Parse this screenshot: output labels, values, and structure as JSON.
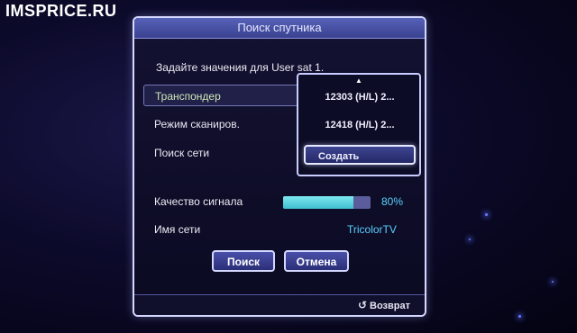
{
  "watermark": "IMSPRICE.RU",
  "dialog": {
    "title": "Поиск спутника",
    "hint": "Задайте значения для User sat 1.",
    "rows": [
      {
        "label": "Транспондер"
      },
      {
        "label": "Режим сканиров."
      },
      {
        "label": "Поиск сети"
      }
    ],
    "dropdown": {
      "items": [
        "12303 (H/L) 2...",
        "12418 (H/L) 2...",
        "Создать"
      ],
      "selected": "Создать"
    },
    "signal": {
      "label": "Качество сигнала",
      "value_text": "80%",
      "fraction": 0.8
    },
    "network": {
      "label": "Имя сети",
      "value": "TricolorTV"
    },
    "buttons": {
      "search": "Поиск",
      "cancel": "Отмена"
    },
    "footer": {
      "return_label": "Возврат"
    }
  },
  "colors": {
    "accent_value": "#5ad0ff",
    "signal_fill": "#3fbfd0",
    "frame": "#d6d8ff"
  }
}
